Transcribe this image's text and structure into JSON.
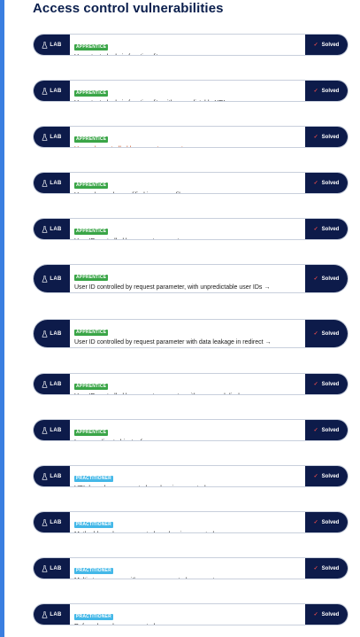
{
  "heading": "Access control vulnerabilities",
  "lab_tag": "LAB",
  "solved_label": "Solved",
  "arrow_glyph": "→",
  "labs": [
    {
      "level": "APPRENTICE",
      "title": "Unprotected admin functionality",
      "highlight": false
    },
    {
      "level": "APPRENTICE",
      "title": "Unprotected admin functionality with unpredictable URL",
      "highlight": false
    },
    {
      "level": "APPRENTICE",
      "title": "User role controlled by request parameter",
      "highlight": true
    },
    {
      "level": "APPRENTICE",
      "title": "User role can be modified in user profile",
      "highlight": false
    },
    {
      "level": "APPRENTICE",
      "title": "User ID controlled by request parameter",
      "highlight": false
    },
    {
      "level": "APPRENTICE",
      "title": "User ID controlled by request parameter, with unpredictable user IDs",
      "highlight": false
    },
    {
      "level": "APPRENTICE",
      "title": "User ID controlled by request parameter with data leakage in redirect",
      "highlight": false
    },
    {
      "level": "APPRENTICE",
      "title": "User ID controlled by request parameter with password disclosure",
      "highlight": false
    },
    {
      "level": "APPRENTICE",
      "title": "Insecure direct object references",
      "highlight": false
    },
    {
      "level": "PRACTITIONER",
      "title": "URL-based access control can be circumvented",
      "highlight": false
    },
    {
      "level": "PRACTITIONER",
      "title": "Method-based access control can be circumvented",
      "highlight": false
    },
    {
      "level": "PRACTITIONER",
      "title": "Multi-step process with no access control on one step",
      "highlight": false
    },
    {
      "level": "PRACTITIONER",
      "title": "Referer-based access control",
      "highlight": false
    }
  ],
  "colors": {
    "navy": "#0d1b4a",
    "apprentice": "#3aa547",
    "practitioner": "#44b8e8",
    "highlight_text": "#c84a1a",
    "check": "#e34a4a"
  }
}
